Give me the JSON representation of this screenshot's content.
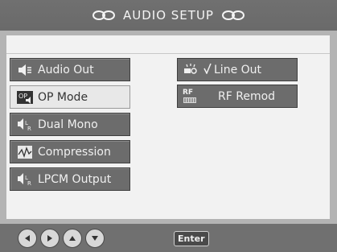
{
  "header": {
    "title": "AUDIO SETUP"
  },
  "menu": {
    "items": [
      {
        "label": "Audio Out",
        "icon": "speaker-icon"
      },
      {
        "label": "OP Mode",
        "icon": "op-mode-icon",
        "selected": true
      },
      {
        "label": "Dual Mono",
        "icon": "dual-mono-icon"
      },
      {
        "label": "Compression",
        "icon": "compression-icon"
      },
      {
        "label": "LPCM Output",
        "icon": "lpcm-icon"
      }
    ]
  },
  "submenu": {
    "items": [
      {
        "label": "Line Out",
        "icon": "line-out-icon",
        "checked": true
      },
      {
        "label": "RF Remod",
        "icon": "rf-remod-icon",
        "badge": "RF"
      }
    ]
  },
  "footer": {
    "enter_label": "Enter"
  },
  "colors": {
    "header": "#707070",
    "panel": "#f2f2f2",
    "item": "#6c6c6c",
    "selected": "#e8e8e8"
  }
}
